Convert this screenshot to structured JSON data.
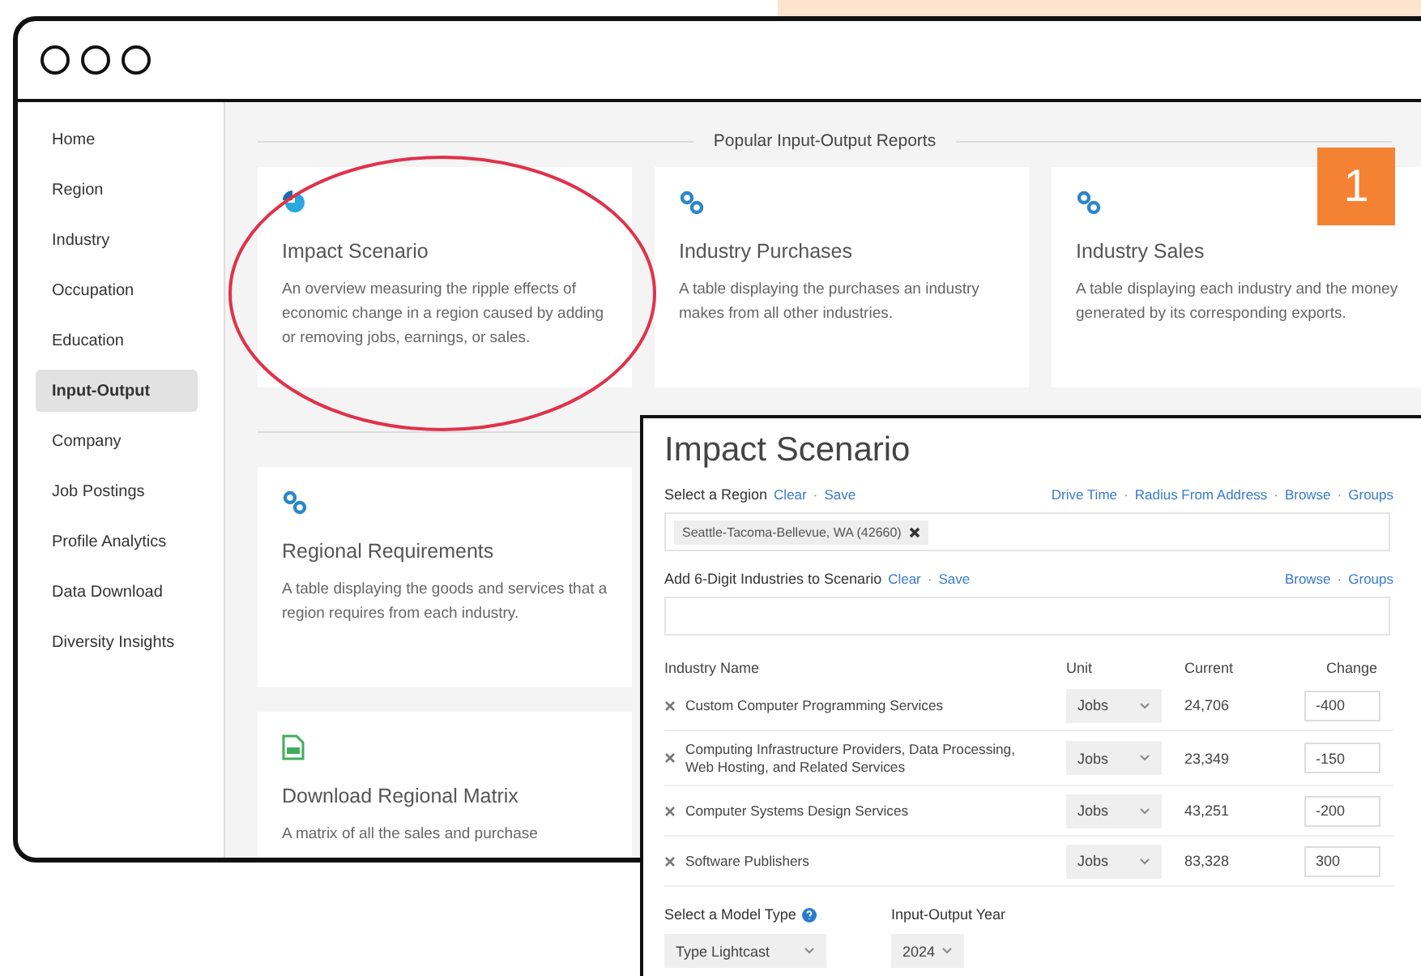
{
  "sidebar": {
    "items": [
      {
        "label": "Home",
        "selected": false
      },
      {
        "label": "Region",
        "selected": false
      },
      {
        "label": "Industry",
        "selected": false
      },
      {
        "label": "Occupation",
        "selected": false
      },
      {
        "label": "Education",
        "selected": false
      },
      {
        "label": "Input-Output",
        "selected": true
      },
      {
        "label": "Company",
        "selected": false
      },
      {
        "label": "Job Postings",
        "selected": false
      },
      {
        "label": "Profile Analytics",
        "selected": false
      },
      {
        "label": "Data Download",
        "selected": false
      },
      {
        "label": "Diversity Insights",
        "selected": false
      }
    ]
  },
  "main": {
    "section_title": "Popular Input-Output Reports",
    "card_rows": [
      [
        {
          "kind": "pie",
          "title": "Impact Scenario",
          "description": "An overview measuring the ripple effects of economic change in a region caused by adding or removing jobs, earnings, or sales."
        },
        {
          "kind": "link",
          "title": "Industry Purchases",
          "description": "A table displaying the purchases an industry makes from all other industries."
        },
        {
          "kind": "link",
          "title": "Industry Sales",
          "description": "A table displaying each industry and the money generated by its corresponding exports."
        }
      ],
      [
        {
          "kind": "link",
          "title": "Regional Requirements",
          "description": "A table displaying the goods and services that a region requires from each industry."
        }
      ],
      [
        {
          "kind": "file",
          "title": "Download Regional Matrix",
          "description": "A matrix of all the sales and purchase"
        }
      ]
    ]
  },
  "badge": "1",
  "panel": {
    "title": "Impact Scenario",
    "separator": "·",
    "region": {
      "label": "Select a Region",
      "actions": [
        "Clear",
        "Save"
      ],
      "links": [
        "Drive Time",
        "Radius From Address",
        "Browse",
        "Groups"
      ],
      "chips": [
        "Seattle-Tacoma-Bellevue, WA (42660)"
      ]
    },
    "industries": {
      "label": "Add 6-Digit Industries to Scenario",
      "actions": [
        "Clear",
        "Save"
      ],
      "links": [
        "Browse",
        "Groups"
      ]
    },
    "table": {
      "columns": [
        "Industry Name",
        "Unit",
        "Current",
        "Change"
      ],
      "rows": [
        {
          "name": "Custom Computer Programming Services",
          "unit": "Jobs",
          "current": "24,706",
          "change": "-400"
        },
        {
          "name": "Computing Infrastructure Providers, Data Processing, Web Hosting, and Related Services",
          "unit": "Jobs",
          "current": "23,349",
          "change": "-150"
        },
        {
          "name": "Computer Systems Design Services",
          "unit": "Jobs",
          "current": "43,251",
          "change": "-200"
        },
        {
          "name": "Software Publishers",
          "unit": "Jobs",
          "current": "83,328",
          "change": "300"
        }
      ]
    },
    "model_type": {
      "label": "Select a Model Type",
      "value": "Type Lightcast"
    },
    "year": {
      "label": "Input-Output Year",
      "value": "2024"
    }
  }
}
